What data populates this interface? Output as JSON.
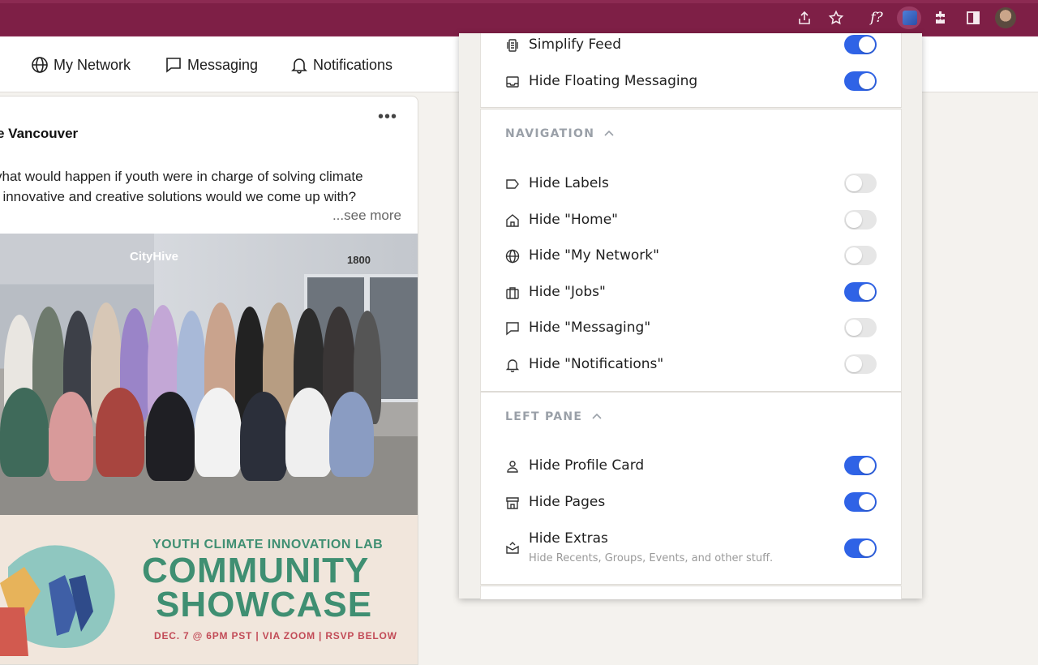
{
  "browser": {
    "extension_fx_label": "f?"
  },
  "nav": {
    "items": [
      {
        "label": "My Network",
        "icon": "globe-icon"
      },
      {
        "label": "Messaging",
        "icon": "message-icon"
      },
      {
        "label": "Notifications",
        "icon": "bell-icon"
      }
    ]
  },
  "post": {
    "author": "e Vancouver",
    "text_line1": "vhat would happen if youth were in charge of solving climate",
    "text_line2": "t innovative and creative solutions would we come up with?",
    "see_more": "...see more",
    "photo_logo": "CityHive",
    "photo_number": "1800",
    "banner": {
      "line1": "YOUTH CLIMATE INNOVATION LAB",
      "line2": "COMMUNITY",
      "line3": "SHOWCASE",
      "line4": "DEC. 7 @ 6PM PST | VIA ZOOM | RSVP BELOW"
    }
  },
  "panel": {
    "general": [
      {
        "label": "Simplify Feed",
        "on": true,
        "icon": "phone-feed-icon"
      },
      {
        "label": "Hide Floating Messaging",
        "on": true,
        "icon": "inbox-icon"
      }
    ],
    "navigation": {
      "title": "NAVIGATION",
      "items": [
        {
          "label": "Hide Labels",
          "on": false,
          "icon": "tag-icon"
        },
        {
          "label": "Hide \"Home\"",
          "on": false,
          "icon": "home-icon"
        },
        {
          "label": "Hide \"My Network\"",
          "on": false,
          "icon": "globe-icon"
        },
        {
          "label": "Hide \"Jobs\"",
          "on": true,
          "icon": "briefcase-icon"
        },
        {
          "label": "Hide \"Messaging\"",
          "on": false,
          "icon": "message-icon"
        },
        {
          "label": "Hide \"Notifications\"",
          "on": false,
          "icon": "bell-icon"
        }
      ]
    },
    "left_pane": {
      "title": "LEFT PANE",
      "items": [
        {
          "label": "Hide Profile Card",
          "on": true,
          "icon": "user-icon"
        },
        {
          "label": "Hide Pages",
          "on": true,
          "icon": "store-icon"
        },
        {
          "label": "Hide Extras",
          "sub": "Hide Recents, Groups, Events, and other stuff.",
          "on": true,
          "icon": "extras-icon"
        }
      ]
    }
  }
}
